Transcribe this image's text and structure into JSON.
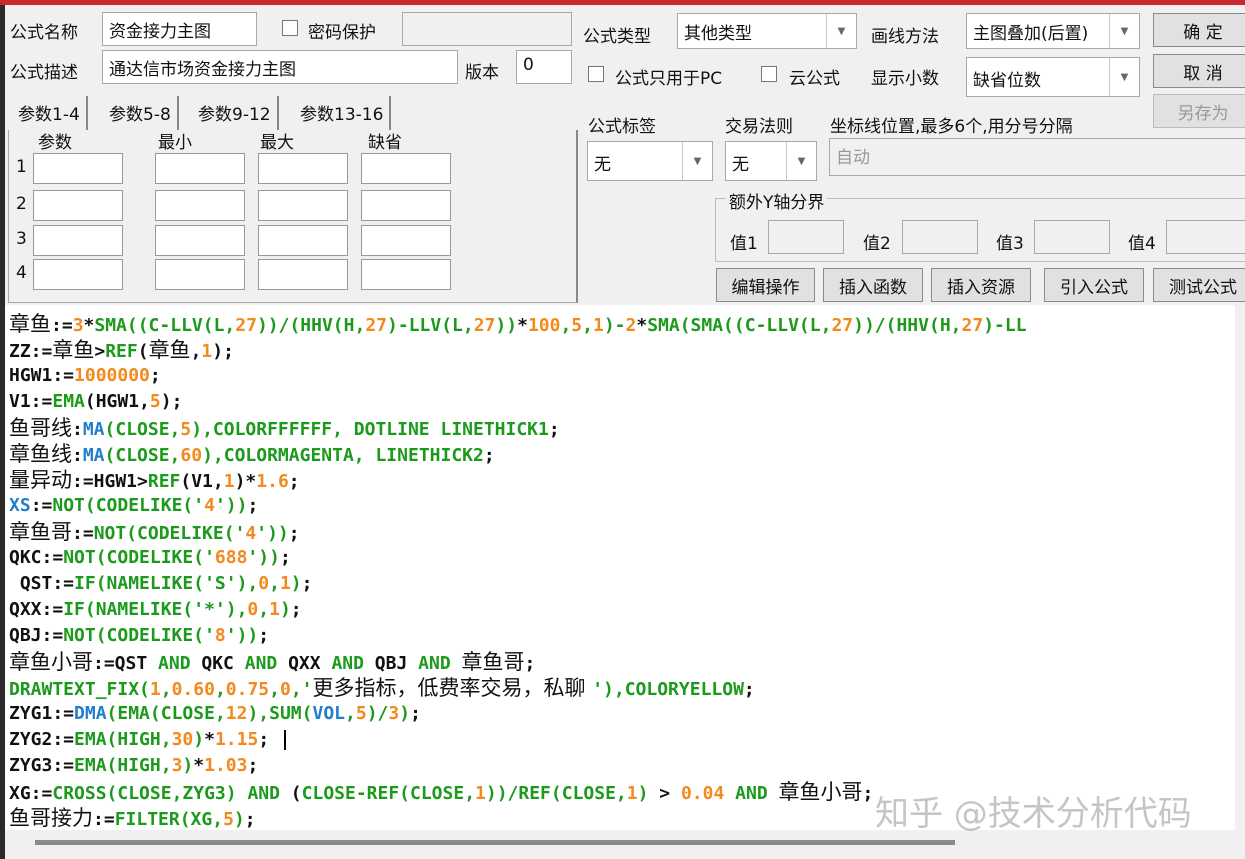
{
  "form": {
    "name_label": "公式名称",
    "name_value": "资金接力主图",
    "password_label": "密码保护",
    "desc_label": "公式描述",
    "desc_value": "通达信市场资金接力主图",
    "version_label": "版本",
    "version_value": "0",
    "type_label": "公式类型",
    "type_value": "其他类型",
    "draw_label": "画线方法",
    "draw_value": "主图叠加(后置)",
    "pc_only_label": "公式只用于PC",
    "cloud_label": "云公式",
    "decimals_label": "显示小数",
    "decimals_value": "缺省位数",
    "tag_label": "公式标签",
    "tag_value": "无",
    "rule_label": "交易法则",
    "rule_value": "无",
    "axis_label": "坐标线位置,最多6个,用分号分隔",
    "axis_placeholder": "自动",
    "yaxis_group": "额外Y轴分界",
    "yvals": [
      "值1",
      "值2",
      "值3",
      "值4"
    ]
  },
  "buttons": {
    "ok": "确  定",
    "cancel": "取  消",
    "save_as": "另存为",
    "edit": "编辑操作",
    "insert_func": "插入函数",
    "insert_res": "插入资源",
    "import": "引入公式",
    "test": "测试公式"
  },
  "tabs": [
    "参数1-4",
    "参数5-8",
    "参数9-12",
    "参数13-16"
  ],
  "param_headers": [
    "参数",
    "最小",
    "最大",
    "缺省"
  ],
  "param_rows": [
    "1",
    "2",
    "3",
    "4"
  ],
  "watermark": "知乎 @技术分析代码",
  "code": {
    "lines": [
      [
        [
          "k",
          "章鱼"
        ],
        [
          "k",
          ":="
        ],
        [
          "o",
          "3"
        ],
        [
          "k",
          "*"
        ],
        [
          "g",
          "SMA((C-LLV(L,"
        ],
        [
          "o",
          "27"
        ],
        [
          "g",
          "))/(HHV(H,"
        ],
        [
          "o",
          "27"
        ],
        [
          "g",
          ")-LLV(L,"
        ],
        [
          "o",
          "27"
        ],
        [
          "g",
          "))"
        ],
        [
          "k",
          "*"
        ],
        [
          "o",
          "100"
        ],
        [
          "g",
          ","
        ],
        [
          "o",
          "5"
        ],
        [
          "g",
          ","
        ],
        [
          "o",
          "1"
        ],
        [
          "g",
          ")-"
        ],
        [
          "o",
          "2"
        ],
        [
          "k",
          "*"
        ],
        [
          "g",
          "SMA(SMA((C-LLV(L,"
        ],
        [
          "o",
          "27"
        ],
        [
          "g",
          "))/(HHV(H,"
        ],
        [
          "o",
          "27"
        ],
        [
          "g",
          ")-LL"
        ]
      ],
      [
        [
          "k",
          "ZZ:="
        ],
        [
          "k",
          "章鱼"
        ],
        [
          "k",
          ">"
        ],
        [
          "g",
          "REF"
        ],
        [
          "k",
          "("
        ],
        [
          "k",
          "章鱼"
        ],
        [
          "k",
          ","
        ],
        [
          "o",
          "1"
        ],
        [
          "k",
          ");"
        ]
      ],
      [
        [
          "k",
          "HGW1:="
        ],
        [
          "o",
          "1000000"
        ],
        [
          "k",
          ";"
        ]
      ],
      [
        [
          "k",
          "V1:="
        ],
        [
          "g",
          "EMA"
        ],
        [
          "k",
          "(HGW1,"
        ],
        [
          "o",
          "5"
        ],
        [
          "k",
          ");"
        ]
      ],
      [
        [
          "k",
          "鱼哥线"
        ],
        [
          "k",
          ":"
        ],
        [
          "b",
          "MA"
        ],
        [
          "g",
          "(CLOSE,"
        ],
        [
          "o",
          "5"
        ],
        [
          "g",
          "),COLORFFFFFF, DOTLINE LINETHICK1"
        ],
        [
          "k",
          ";"
        ]
      ],
      [
        [
          "k",
          "章鱼线"
        ],
        [
          "k",
          ":"
        ],
        [
          "b",
          "MA"
        ],
        [
          "g",
          "(CLOSE,"
        ],
        [
          "o",
          "60"
        ],
        [
          "g",
          "),COLORMAGENTA, LINETHICK2"
        ],
        [
          "k",
          ";"
        ]
      ],
      [
        [
          "k",
          "量异动"
        ],
        [
          "k",
          ":=HGW1>"
        ],
        [
          "g",
          "REF"
        ],
        [
          "k",
          "(V1,"
        ],
        [
          "o",
          "1"
        ],
        [
          "k",
          ")*"
        ],
        [
          "o",
          "1.6"
        ],
        [
          "k",
          ";"
        ]
      ],
      [
        [
          "b",
          "XS"
        ],
        [
          "k",
          ":="
        ],
        [
          "g",
          "NOT(CODELIKE('"
        ],
        [
          "o",
          "4"
        ],
        [
          "g",
          "'))"
        ],
        [
          "k",
          ";"
        ]
      ],
      [
        [
          "k",
          "章鱼哥"
        ],
        [
          "k",
          ":="
        ],
        [
          "g",
          "NOT(CODELIKE('"
        ],
        [
          "o",
          "4"
        ],
        [
          "g",
          "'))"
        ],
        [
          "k",
          ";"
        ]
      ],
      [
        [
          "k",
          "QKC:="
        ],
        [
          "g",
          "NOT(CODELIKE('"
        ],
        [
          "o",
          "688"
        ],
        [
          "g",
          "'))"
        ],
        [
          "k",
          ";"
        ]
      ],
      [
        [
          "k",
          " QST:="
        ],
        [
          "g",
          "IF(NAMELIKE('S'),"
        ],
        [
          "o",
          "0"
        ],
        [
          "g",
          ","
        ],
        [
          "o",
          "1"
        ],
        [
          "g",
          ")"
        ],
        [
          "k",
          ";"
        ]
      ],
      [
        [
          "k",
          "QXX:="
        ],
        [
          "g",
          "IF(NAMELIKE('*'),"
        ],
        [
          "o",
          "0"
        ],
        [
          "g",
          ","
        ],
        [
          "o",
          "1"
        ],
        [
          "g",
          ")"
        ],
        [
          "k",
          ";"
        ]
      ],
      [
        [
          "k",
          "QBJ:="
        ],
        [
          "g",
          "NOT(CODELIKE('"
        ],
        [
          "o",
          "8"
        ],
        [
          "g",
          "'))"
        ],
        [
          "k",
          ";"
        ]
      ],
      [
        [
          "k",
          "章鱼小哥"
        ],
        [
          "k",
          ":=QST "
        ],
        [
          "g",
          "AND"
        ],
        [
          "k",
          " QKC "
        ],
        [
          "g",
          "AND"
        ],
        [
          "k",
          " QXX "
        ],
        [
          "g",
          "AND"
        ],
        [
          "k",
          " QBJ "
        ],
        [
          "g",
          "AND"
        ],
        [
          "k",
          " "
        ],
        [
          "k",
          "章鱼哥"
        ],
        [
          "k",
          ";"
        ]
      ],
      [
        [
          "g",
          "DRAWTEXT_FIX("
        ],
        [
          "o",
          "1"
        ],
        [
          "g",
          ","
        ],
        [
          "o",
          "0.60"
        ],
        [
          "g",
          ","
        ],
        [
          "o",
          "0.75"
        ],
        [
          "g",
          ","
        ],
        [
          "o",
          "0"
        ],
        [
          "g",
          ",'"
        ],
        [
          "k",
          "更多指标，低费率交易，私聊 "
        ],
        [
          "g",
          "'),COLORYELLOW"
        ],
        [
          "k",
          ";"
        ]
      ],
      [
        [
          "k",
          "ZYG1:="
        ],
        [
          "b",
          "DMA"
        ],
        [
          "g",
          "(EMA(CLOSE,"
        ],
        [
          "o",
          "12"
        ],
        [
          "g",
          "),SUM("
        ],
        [
          "b",
          "VOL"
        ],
        [
          "g",
          ","
        ],
        [
          "o",
          "5"
        ],
        [
          "g",
          ")/"
        ],
        [
          "o",
          "3"
        ],
        [
          "g",
          ")"
        ],
        [
          "k",
          ";"
        ]
      ],
      [
        [
          "k",
          "ZYG2:="
        ],
        [
          "g",
          "EMA(HIGH,"
        ],
        [
          "o",
          "30"
        ],
        [
          "g",
          ")"
        ],
        [
          "k",
          "*"
        ],
        [
          "o",
          "1.15"
        ],
        [
          "k",
          "; "
        ]
      ],
      [
        [
          "k",
          "ZYG3:="
        ],
        [
          "g",
          "EMA(HIGH,"
        ],
        [
          "o",
          "3"
        ],
        [
          "g",
          ")"
        ],
        [
          "k",
          "*"
        ],
        [
          "o",
          "1.03"
        ],
        [
          "k",
          ";"
        ]
      ],
      [
        [
          "k",
          "XG:="
        ],
        [
          "g",
          "CROSS(CLOSE,ZYG3)"
        ],
        [
          "k",
          " "
        ],
        [
          "g",
          "AND"
        ],
        [
          "k",
          " ("
        ],
        [
          "g",
          "CLOSE-REF(CLOSE,"
        ],
        [
          "o",
          "1"
        ],
        [
          "g",
          "))/REF(CLOSE,"
        ],
        [
          "o",
          "1"
        ],
        [
          "g",
          ")"
        ],
        [
          "k",
          " > "
        ],
        [
          "o",
          "0.04"
        ],
        [
          "k",
          " "
        ],
        [
          "g",
          "AND"
        ],
        [
          "k",
          " "
        ],
        [
          "k",
          "章鱼小哥"
        ],
        [
          "k",
          ";"
        ]
      ],
      [
        [
          "k",
          "鱼哥接力"
        ],
        [
          "k",
          ":="
        ],
        [
          "g",
          "FILTER(XG,"
        ],
        [
          "o",
          "5"
        ],
        [
          "g",
          ")"
        ],
        [
          "k",
          ";"
        ]
      ]
    ]
  },
  "colors": {
    "title_bar": "#c9282d",
    "keyword": "#1b9a1b",
    "number": "#f28a1e",
    "builtin": "#1f7fce"
  }
}
